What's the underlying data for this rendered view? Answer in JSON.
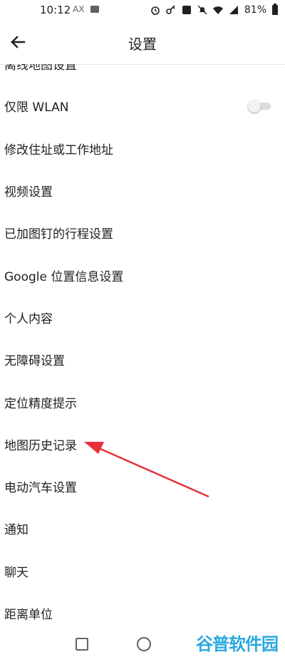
{
  "status_bar": {
    "time": "10:12",
    "ax_label": "AX",
    "battery": "81%"
  },
  "app_bar": {
    "title": "设置"
  },
  "settings": {
    "items": [
      {
        "label": "离线地图设置"
      },
      {
        "label": "仅限 WLAN",
        "toggle": "off"
      },
      {
        "label": "修改住址或工作地址"
      },
      {
        "label": "视频设置"
      },
      {
        "label": "已加图钉的行程设置"
      },
      {
        "label": "Google 位置信息设置"
      },
      {
        "label": "个人内容"
      },
      {
        "label": "无障碍设置"
      },
      {
        "label": "定位精度提示"
      },
      {
        "label": "地图历史记录"
      },
      {
        "label": "电动汽车设置"
      },
      {
        "label": "通知"
      },
      {
        "label": "聊天"
      },
      {
        "label": "距离单位"
      }
    ]
  },
  "annotation": {
    "target": "地图历史记录",
    "color": "#e8323a"
  },
  "watermark": "谷普软件园"
}
